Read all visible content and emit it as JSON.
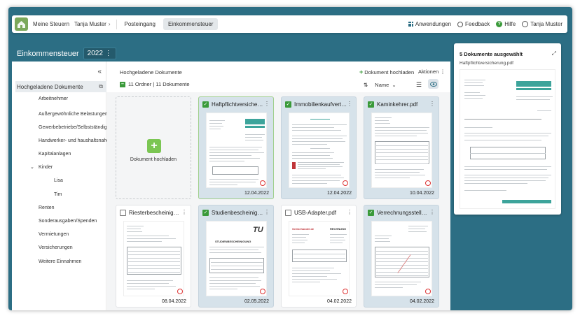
{
  "topbar": {
    "home_label": "Meine Steuern",
    "user_crumb": "Tanja Muster",
    "tab_inbox": "Posteingang",
    "tab_income_tax": "Einkommensteuer",
    "apps_label": "Anwendungen",
    "feedback_label": "Feedback",
    "help_label": "Hilfe",
    "user_label": "Tanja Muster"
  },
  "page": {
    "title": "Einkommensteuer",
    "year": "2022"
  },
  "sidebar": {
    "collapse_glyph": "«",
    "items": [
      {
        "label": "Hochgeladene Dokumente",
        "selected": true
      },
      {
        "label": "Arbeitnehmer"
      },
      {
        "label": "Außergewöhnliche Belastungen"
      },
      {
        "label": "Gewerbebetriebe/Selbstständigk..."
      },
      {
        "label": "Handwerker- und haushaltsnahe ..."
      },
      {
        "label": "Kapitalanlagen"
      },
      {
        "label": "Kinder"
      },
      {
        "label": "Lisa"
      },
      {
        "label": "Tim"
      },
      {
        "label": "Renten"
      },
      {
        "label": "Sonderausgaben/Spenden"
      },
      {
        "label": "Vermietungen"
      },
      {
        "label": "Versicherungen"
      },
      {
        "label": "Weitere Einnahmen"
      }
    ]
  },
  "content": {
    "title": "Hochgeladene Dokumente",
    "upload_label": "Dokument hochladen",
    "actions_label": "Aktionen",
    "count_label": "11 Ordner | 11 Dokumente",
    "sort_label": "Name",
    "upload_card_label": "Dokument hochladen"
  },
  "documents": [
    {
      "title": "Haftpflichtversicherun...",
      "date": "12.04.2022",
      "checked": true
    },
    {
      "title": "Immobilienkaufvertra...",
      "date": "12.04.2022",
      "checked": true
    },
    {
      "title": "Kaminkehrer.pdf",
      "date": "10.04.2022",
      "checked": true
    },
    {
      "title": "Riesterbescheinigung...",
      "date": "08.04.2022",
      "checked": false
    },
    {
      "title": "Studienbescheinigun...",
      "date": "02.05.2022",
      "checked": true
    },
    {
      "title": "USB-Adapter.pdf",
      "date": "04.02.2022",
      "checked": false
    },
    {
      "title": "Verrechnungsstelle.pdf",
      "date": "04.02.2022",
      "checked": true
    }
  ],
  "thumb_text": {
    "logo_tu": "TU",
    "studien_head": "STUDIENBESCHEINIGUNG",
    "usb_shop": "Onlinehandel.de",
    "usb_rechnung": "RECHNUNG"
  },
  "preview": {
    "title": "5 Dokumente ausgewählt",
    "filename": "Haftpflichtversicherung.pdf"
  },
  "colors": {
    "brand": "#2c6e84",
    "accent_green": "#3a9a3a",
    "selected_card": "#d6e2ea"
  }
}
